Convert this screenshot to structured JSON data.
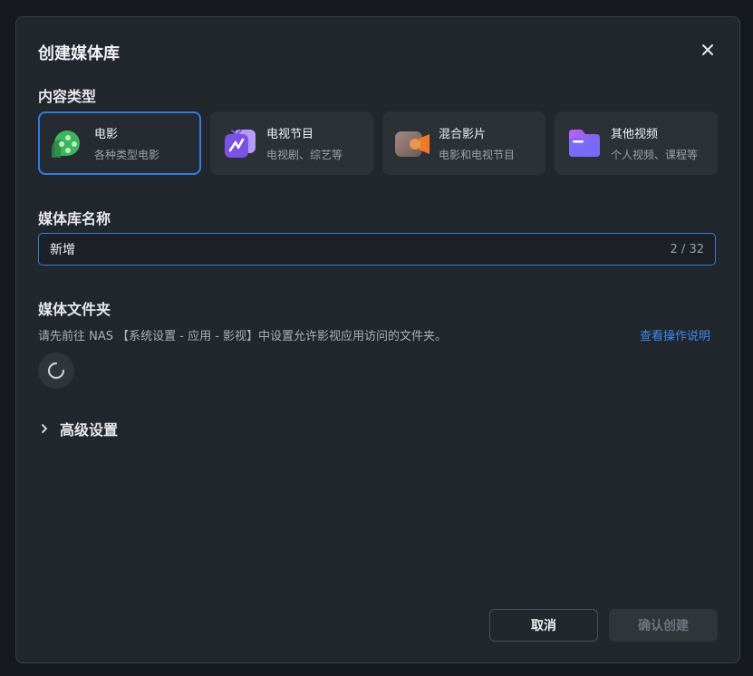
{
  "dialog": {
    "title": "创建媒体库",
    "close_icon": "close-icon"
  },
  "content_type": {
    "label": "内容类型",
    "selected": "电影",
    "options": [
      {
        "name": "电影",
        "desc": "各种类型电影",
        "icon": "movie-film-icon",
        "color": "#3db55c"
      },
      {
        "name": "电视节目",
        "desc": "电视剧、综艺等",
        "icon": "tv-icon",
        "color": "#8a62f0"
      },
      {
        "name": "混合影片",
        "desc": "电影和电视节目",
        "icon": "video-camera-icon",
        "color": "#f07a2a"
      },
      {
        "name": "其他视频",
        "desc": "个人视频、课程等",
        "icon": "folder-icon",
        "color": "#6a5cf6"
      }
    ]
  },
  "library_name": {
    "label": "媒体库名称",
    "value": "新增",
    "counter": "2 / 32"
  },
  "media_folder": {
    "label": "媒体文件夹",
    "hint": "请先前往 NAS 【系统设置 - 应用 - 影视】中设置允许影视应用访问的文件夹。",
    "help_link": "查看操作说明"
  },
  "advanced": {
    "label": "高级设置"
  },
  "footer": {
    "cancel_label": "取消",
    "confirm_label": "确认创建"
  },
  "colors": {
    "accent": "#2f7de1",
    "link": "#3a8bef"
  }
}
